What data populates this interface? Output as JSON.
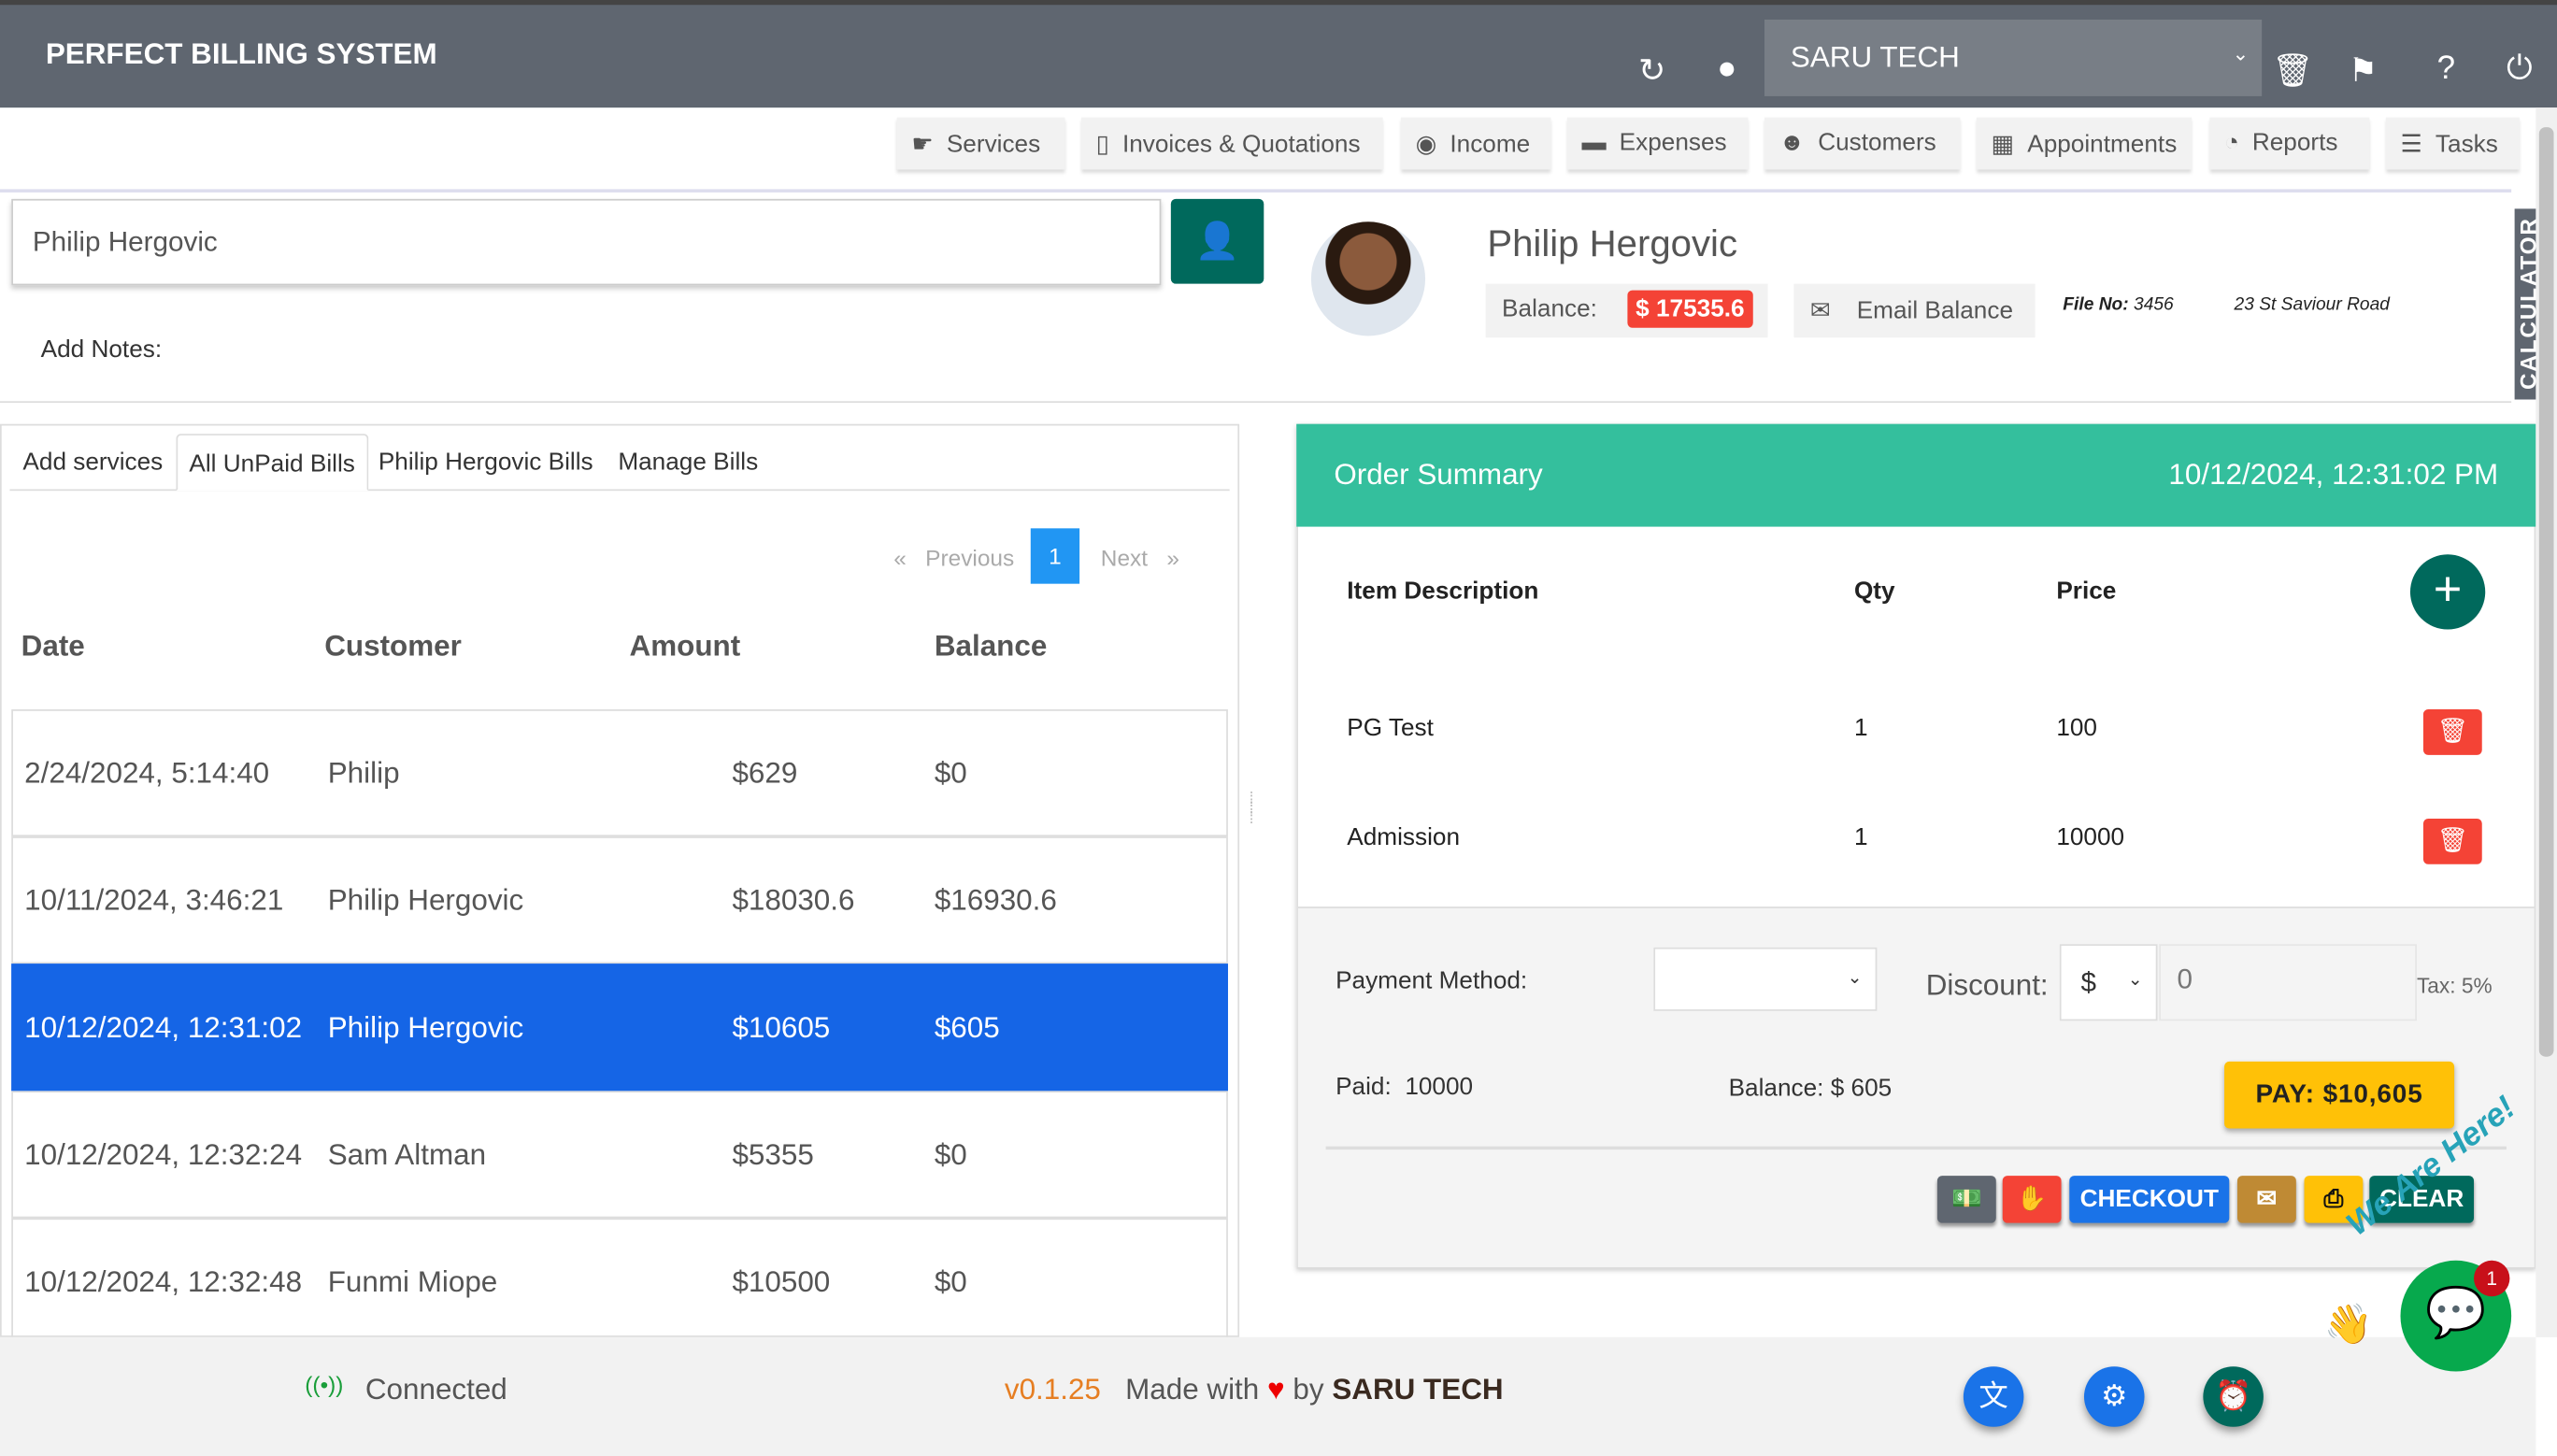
{
  "app": {
    "title": "PERFECT BILLING SYSTEM",
    "company": "SARU TECH"
  },
  "header_icons": [
    "refresh-icon",
    "user-circle-icon",
    "trash-icon",
    "flag-icon",
    "help-icon",
    "power-icon"
  ],
  "nav": [
    {
      "label": "Services",
      "icon": "hand-icon"
    },
    {
      "label": "Invoices & Quotations",
      "icon": "file-invoice-icon"
    },
    {
      "label": "Income",
      "icon": "coins-icon"
    },
    {
      "label": "Expenses",
      "icon": "money-bill-icon"
    },
    {
      "label": "Customers",
      "icon": "users-icon"
    },
    {
      "label": "Appointments",
      "icon": "calendar-icon"
    },
    {
      "label": "Reports",
      "icon": "pie-chart-icon"
    },
    {
      "label": "Tasks",
      "icon": "tasks-icon"
    }
  ],
  "customer": {
    "search_value": "Philip Hergovic",
    "add_notes_label": "Add Notes:",
    "name": "Philip Hergovic",
    "balance_label": "Balance:",
    "balance": "$ 17535.6",
    "email_balance": "Email Balance",
    "file_no_label": "File No:",
    "file_no": "3456",
    "address": "23 St Saviour Road"
  },
  "calculator": "CALCULATOR",
  "tabs": [
    "Add services",
    "All UnPaid Bills",
    "Philip Hergovic Bills",
    "Manage Bills"
  ],
  "pager": {
    "prev": "Previous",
    "page": "1",
    "next": "Next"
  },
  "bills": {
    "columns": [
      "Date",
      "Customer",
      "Amount",
      "Balance"
    ],
    "rows": [
      [
        "2/24/2024, 5:14:40",
        "Philip",
        "$629",
        "$0"
      ],
      [
        "10/11/2024, 3:46:21",
        "Philip Hergovic",
        "$18030.6",
        "$16930.6"
      ],
      [
        "10/12/2024, 12:31:02",
        "Philip Hergovic",
        "$10605",
        "$605"
      ],
      [
        "10/12/2024, 12:32:24",
        "Sam Altman",
        "$5355",
        "$0"
      ],
      [
        "10/12/2024, 12:32:48",
        "Funmi Miope",
        "$10500",
        "$0"
      ]
    ],
    "selected_index": 2
  },
  "order": {
    "title": "Order Summary",
    "datetime": "10/12/2024, 12:31:02 PM",
    "columns": [
      "Item Description",
      "Qty",
      "Price"
    ],
    "items": [
      {
        "desc": "PG Test",
        "qty": "1",
        "price": "100"
      },
      {
        "desc": "Admission",
        "qty": "1",
        "price": "10000"
      }
    ],
    "payment_method_label": "Payment Method:",
    "payment_method_value": "",
    "discount_label": "Discount:",
    "discount_type": "$",
    "discount_value": "0",
    "tax": "Tax: 5%",
    "paid_label": "Paid:",
    "paid": "10000",
    "balance": "Balance: $ 605",
    "pay_button": "PAY: $10,605",
    "checkout": "CHECKOUT",
    "clear": "CLEAR"
  },
  "footer": {
    "status": "Connected",
    "version": "v0.1.25",
    "made_with": "Made with",
    "by": "by",
    "brand": "SARU TECH"
  },
  "chat": {
    "tagline": "We Are Here!",
    "badge": "1"
  },
  "colors": {
    "header": "#5f6670",
    "teal": "#00695c",
    "order_header": "#34bf9d",
    "selected_row": "#1565e6",
    "danger": "#f44336",
    "pay": "#ffc107",
    "version": "#e67e22"
  }
}
